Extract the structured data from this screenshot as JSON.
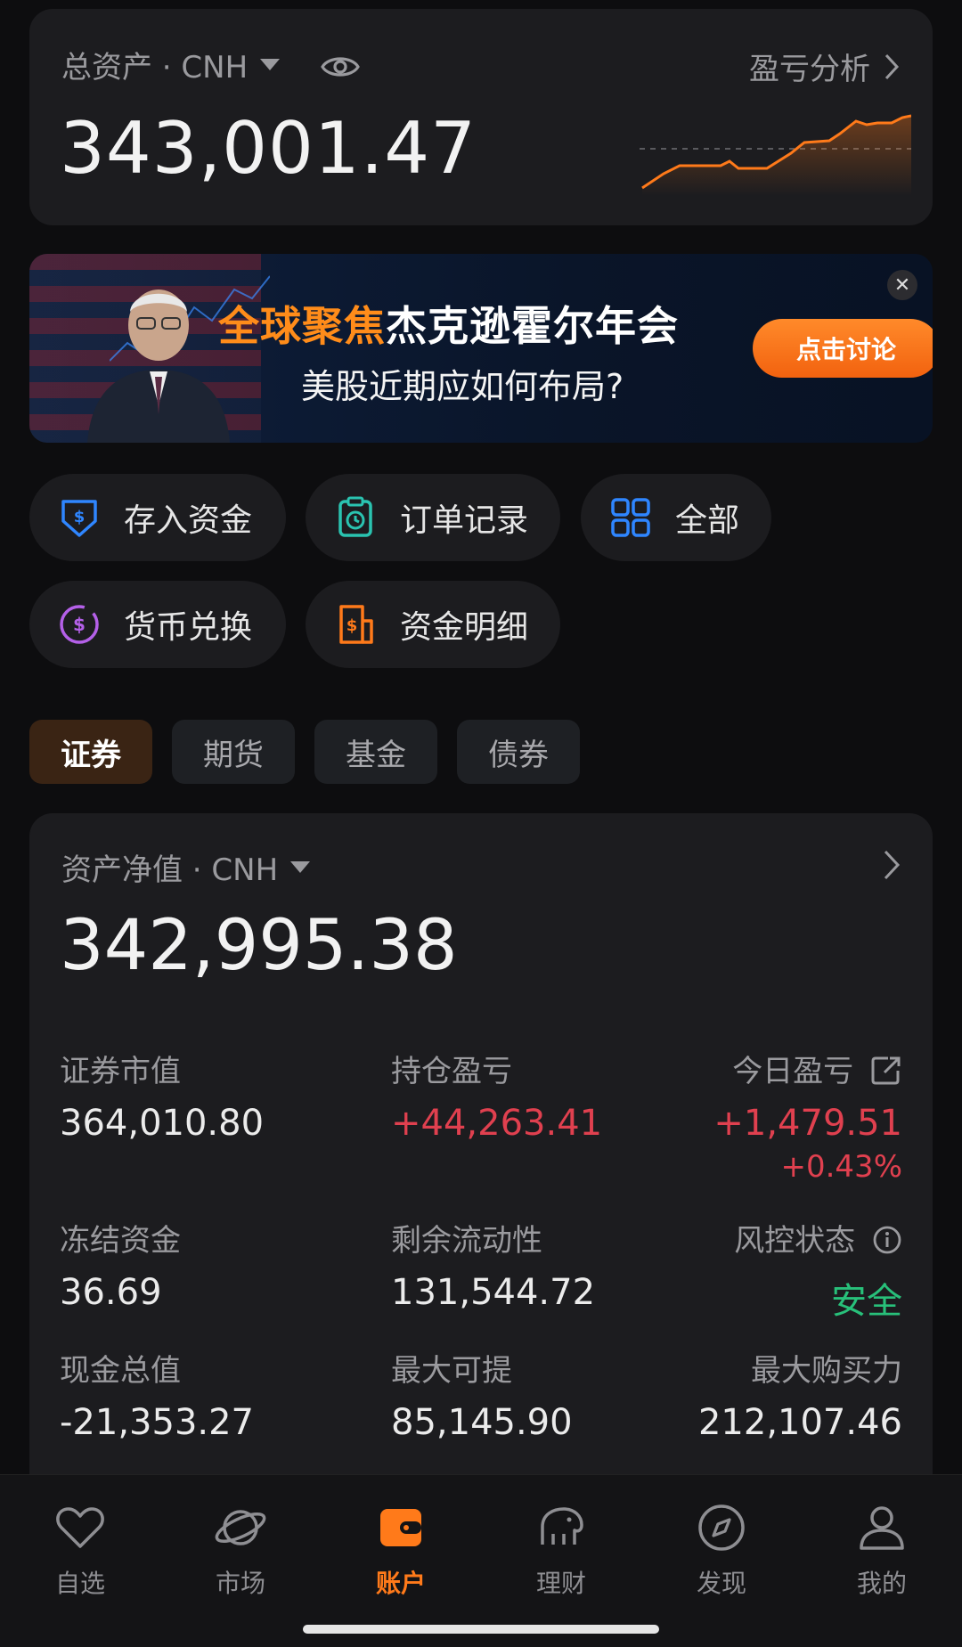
{
  "total": {
    "label": "总资产 · CNH",
    "value": "343,001.47",
    "pnl_link": "盈亏分析"
  },
  "banner": {
    "title_highlight": "全球聚焦",
    "title_main": "杰克逊霍尔年会",
    "subtitle": "美股近期应如何布局?",
    "button": "点击讨论"
  },
  "quick_actions": {
    "deposit": "存入资金",
    "orders": "订单记录",
    "all": "全部",
    "exchange": "货币兑换",
    "details": "资金明细"
  },
  "tabs": [
    "证券",
    "期货",
    "基金",
    "债券"
  ],
  "securities": {
    "net_label": "资产净值 · CNH",
    "net_value": "342,995.38",
    "market_value_label": "证券市值",
    "market_value": "364,010.80",
    "position_pnl_label": "持仓盈亏",
    "position_pnl": "+44,263.41",
    "today_pnl_label": "今日盈亏",
    "today_pnl": "+1,479.51",
    "today_pnl_pct": "+0.43%",
    "frozen_label": "冻结资金",
    "frozen": "36.69",
    "liquidity_label": "剩余流动性",
    "liquidity": "131,544.72",
    "risk_label": "风控状态",
    "risk": "安全",
    "cash_label": "现金总值",
    "cash": "-21,353.27",
    "withdraw_label": "最大可提",
    "withdraw": "85,145.90",
    "buying_power_label": "最大购买力",
    "buying_power": "212,107.46"
  },
  "nav": [
    "自选",
    "市场",
    "账户",
    "理财",
    "发现",
    "我的"
  ],
  "colors": {
    "accent": "#ff7a1a",
    "gain": "#e0404f",
    "safe": "#28c07a"
  }
}
